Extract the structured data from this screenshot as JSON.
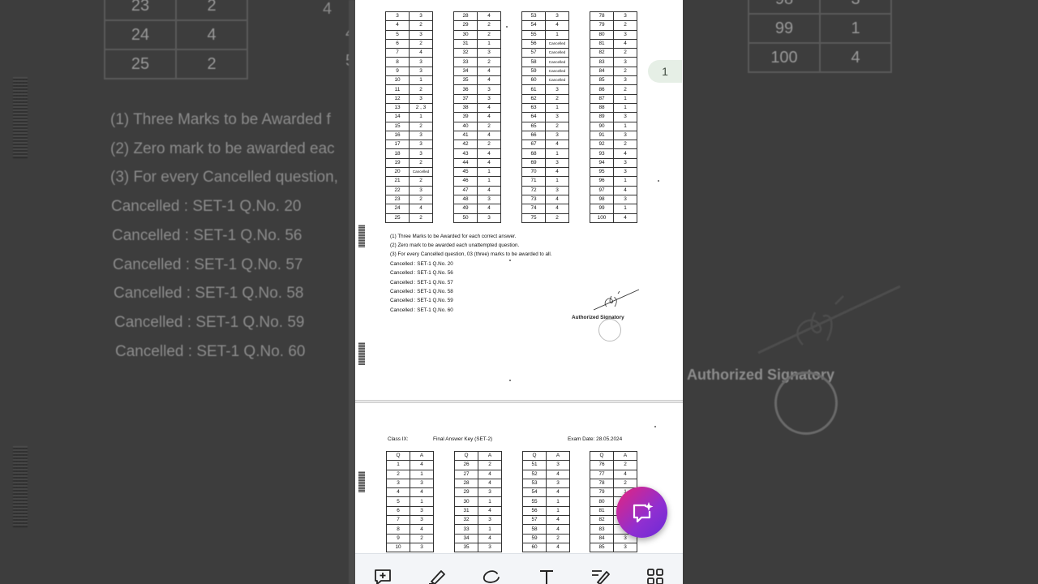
{
  "viewer": {
    "page_indicator": "1"
  },
  "background": {
    "left_table": [
      [
        "23",
        "2"
      ],
      [
        "24",
        "4"
      ],
      [
        "25",
        "2"
      ]
    ],
    "right_table": [
      [
        "98",
        "3"
      ],
      [
        "99",
        "1"
      ],
      [
        "100",
        "4"
      ]
    ],
    "notes": [
      "(1) Three Marks to be Awarded f",
      "(2) Zero mark to be awarded eac",
      "(3) For every Cancelled question,",
      "Cancelled : SET-1 Q.No. 20",
      "Cancelled : SET-1 Q.No. 56",
      "Cancelled : SET-1 Q.No. 57",
      "Cancelled : SET-1 Q.No. 58",
      "Cancelled : SET-1 Q.No. 59",
      "Cancelled : SET-1 Q.No. 60"
    ],
    "signatory": "Authorized Signatory",
    "side_left_fragments": [
      "4",
      "4",
      "5"
    ]
  },
  "page1": {
    "col1": [
      [
        "3",
        "3"
      ],
      [
        "4",
        "2"
      ],
      [
        "5",
        "3"
      ],
      [
        "6",
        "2"
      ],
      [
        "7",
        "4"
      ],
      [
        "8",
        "3"
      ],
      [
        "9",
        "3"
      ],
      [
        "10",
        "1"
      ],
      [
        "11",
        "2"
      ],
      [
        "12",
        "3"
      ],
      [
        "13",
        "2 , 3"
      ],
      [
        "14",
        "1"
      ],
      [
        "15",
        "2"
      ],
      [
        "16",
        "3"
      ],
      [
        "17",
        "3"
      ],
      [
        "18",
        "3"
      ],
      [
        "19",
        "2"
      ],
      [
        "20",
        "Cancelled"
      ],
      [
        "21",
        "2"
      ],
      [
        "22",
        "3"
      ],
      [
        "23",
        "2"
      ],
      [
        "24",
        "4"
      ],
      [
        "25",
        "2"
      ]
    ],
    "col2": [
      [
        "28",
        "4"
      ],
      [
        "29",
        "2"
      ],
      [
        "30",
        "2"
      ],
      [
        "31",
        "1"
      ],
      [
        "32",
        "3"
      ],
      [
        "33",
        "2"
      ],
      [
        "34",
        "4"
      ],
      [
        "35",
        "4"
      ],
      [
        "36",
        "3"
      ],
      [
        "37",
        "3"
      ],
      [
        "38",
        "4"
      ],
      [
        "39",
        "4"
      ],
      [
        "40",
        "2"
      ],
      [
        "41",
        "4"
      ],
      [
        "42",
        "2"
      ],
      [
        "43",
        "4"
      ],
      [
        "44",
        "4"
      ],
      [
        "45",
        "1"
      ],
      [
        "46",
        "1"
      ],
      [
        "47",
        "4"
      ],
      [
        "48",
        "3"
      ],
      [
        "49",
        "4"
      ],
      [
        "50",
        "3"
      ]
    ],
    "col3": [
      [
        "53",
        "3"
      ],
      [
        "54",
        "4"
      ],
      [
        "55",
        "1"
      ],
      [
        "56",
        "Cancelled"
      ],
      [
        "57",
        "Cancelled"
      ],
      [
        "58",
        "Cancelled"
      ],
      [
        "59",
        "Cancelled"
      ],
      [
        "60",
        "Cancelled"
      ],
      [
        "61",
        "3"
      ],
      [
        "62",
        "2"
      ],
      [
        "63",
        "1"
      ],
      [
        "64",
        "3"
      ],
      [
        "65",
        "2"
      ],
      [
        "66",
        "3"
      ],
      [
        "67",
        "4"
      ],
      [
        "68",
        "1"
      ],
      [
        "69",
        "3"
      ],
      [
        "70",
        "4"
      ],
      [
        "71",
        "1"
      ],
      [
        "72",
        "3"
      ],
      [
        "73",
        "4"
      ],
      [
        "74",
        "4"
      ],
      [
        "75",
        "2"
      ]
    ],
    "col4": [
      [
        "78",
        "3"
      ],
      [
        "79",
        "2"
      ],
      [
        "80",
        "3"
      ],
      [
        "81",
        "4"
      ],
      [
        "82",
        "2"
      ],
      [
        "83",
        "3"
      ],
      [
        "84",
        "2"
      ],
      [
        "85",
        "3"
      ],
      [
        "86",
        "2"
      ],
      [
        "87",
        "1"
      ],
      [
        "88",
        "1"
      ],
      [
        "89",
        "3"
      ],
      [
        "90",
        "1"
      ],
      [
        "91",
        "3"
      ],
      [
        "92",
        "2"
      ],
      [
        "93",
        "4"
      ],
      [
        "94",
        "3"
      ],
      [
        "95",
        "3"
      ],
      [
        "96",
        "1"
      ],
      [
        "97",
        "4"
      ],
      [
        "98",
        "3"
      ],
      [
        "99",
        "1"
      ],
      [
        "100",
        "4"
      ]
    ],
    "notes": [
      "(1) Three Marks to be Awarded for each correct answer.",
      "(2) Zero mark to be awarded each unattempted question.",
      "(3) For every Cancelled question, 03 (three) marks to be awarded to all.",
      "Cancelled : SET-1 Q.No. 20",
      "Cancelled : SET-1 Q.No. 56",
      "Cancelled : SET-1 Q.No. 57",
      "Cancelled : SET-1 Q.No. 58",
      "Cancelled : SET-1 Q.No. 59",
      "Cancelled : SET-1 Q.No. 60"
    ],
    "signatory": "Authorized Signatory"
  },
  "page2": {
    "class_label": "Class IX:",
    "title": "Final Answer Key (SET-2)",
    "exam_date": "Exam Date: 28.05.2024",
    "col1": [
      [
        "Q",
        "A"
      ],
      [
        "1",
        "4"
      ],
      [
        "2",
        "1"
      ],
      [
        "3",
        "3"
      ],
      [
        "4",
        "4"
      ],
      [
        "5",
        "1"
      ],
      [
        "6",
        "3"
      ],
      [
        "7",
        "3"
      ],
      [
        "8",
        "4"
      ],
      [
        "9",
        "2"
      ],
      [
        "10",
        "3"
      ]
    ],
    "col2": [
      [
        "Q",
        "A"
      ],
      [
        "26",
        "2"
      ],
      [
        "27",
        "4"
      ],
      [
        "28",
        "4"
      ],
      [
        "29",
        "3"
      ],
      [
        "30",
        "1"
      ],
      [
        "31",
        "4"
      ],
      [
        "32",
        "3"
      ],
      [
        "33",
        "1"
      ],
      [
        "34",
        "4"
      ],
      [
        "35",
        "3"
      ]
    ],
    "col3": [
      [
        "Q",
        "A"
      ],
      [
        "51",
        "3"
      ],
      [
        "52",
        "4"
      ],
      [
        "53",
        "3"
      ],
      [
        "54",
        "4"
      ],
      [
        "55",
        "1"
      ],
      [
        "56",
        "1"
      ],
      [
        "57",
        "4"
      ],
      [
        "58",
        "4"
      ],
      [
        "59",
        "2"
      ],
      [
        "60",
        "4"
      ]
    ],
    "col4": [
      [
        "Q",
        "A"
      ],
      [
        "76",
        "2"
      ],
      [
        "77",
        "4"
      ],
      [
        "78",
        "2"
      ],
      [
        "79",
        "1"
      ],
      [
        "80",
        "3"
      ],
      [
        "81",
        "1"
      ],
      [
        "82",
        "4"
      ],
      [
        "83",
        "3"
      ],
      [
        "84",
        "3"
      ],
      [
        "85",
        "3"
      ]
    ]
  },
  "toolbar": {
    "tools": [
      "add-comment-icon",
      "highlight-icon",
      "draw-icon",
      "text-icon",
      "sign-icon",
      "more-tools-icon"
    ]
  },
  "colors": {
    "fab_start": "#e6247b",
    "fab_end": "#6b2ad6",
    "toolbar_bg": "#f3f5f8"
  }
}
